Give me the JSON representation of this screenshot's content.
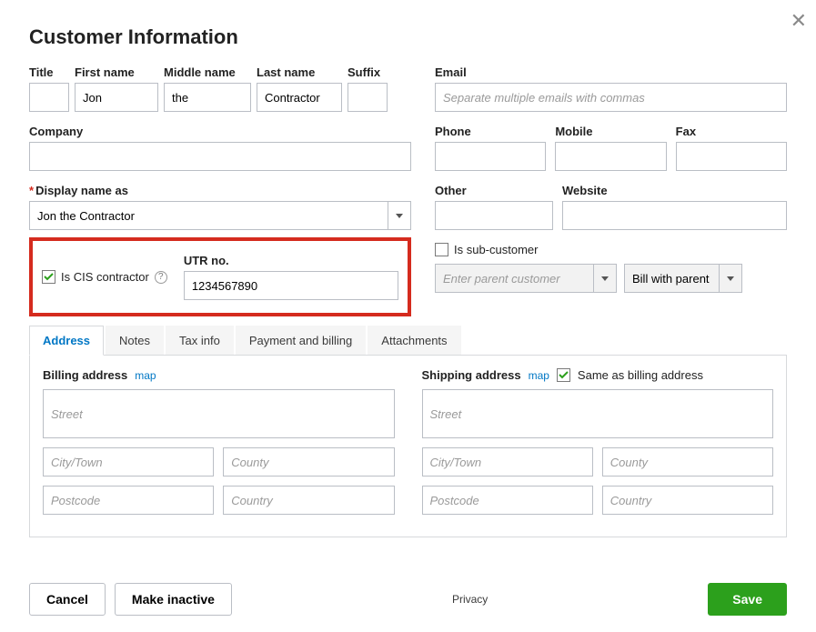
{
  "title": "Customer Information",
  "name": {
    "labels": {
      "title": "Title",
      "first": "First name",
      "middle": "Middle name",
      "last": "Last name",
      "suffix": "Suffix"
    },
    "values": {
      "title": "",
      "first": "Jon",
      "middle": "the",
      "last": "Contractor",
      "suffix": ""
    }
  },
  "company": {
    "label": "Company",
    "value": ""
  },
  "display_name": {
    "label": "Display name as",
    "value": "Jon the Contractor"
  },
  "cis": {
    "label": "Is CIS contractor",
    "checked": true,
    "utr_label": "UTR no.",
    "utr_value": "1234567890"
  },
  "right": {
    "email": {
      "label": "Email",
      "placeholder": "Separate multiple emails with commas",
      "value": ""
    },
    "phone": {
      "label": "Phone",
      "value": ""
    },
    "mobile": {
      "label": "Mobile",
      "value": ""
    },
    "fax": {
      "label": "Fax",
      "value": ""
    },
    "other": {
      "label": "Other",
      "value": ""
    },
    "website": {
      "label": "Website",
      "value": ""
    },
    "subcustomer": {
      "label": "Is sub-customer",
      "checked": false
    },
    "parent": {
      "placeholder": "Enter parent customer",
      "value": ""
    },
    "bill": {
      "value": "Bill with parent"
    }
  },
  "tabs": [
    "Address",
    "Notes",
    "Tax info",
    "Payment and billing",
    "Attachments"
  ],
  "active_tab": 0,
  "address": {
    "billing_label": "Billing address",
    "shipping_label": "Shipping address",
    "map": "map",
    "same_label": "Same as billing address",
    "same_checked": true,
    "placeholders": {
      "street": "Street",
      "city": "City/Town",
      "county": "County",
      "postcode": "Postcode",
      "country": "Country"
    }
  },
  "footer": {
    "cancel": "Cancel",
    "inactive": "Make inactive",
    "privacy": "Privacy",
    "save": "Save"
  }
}
